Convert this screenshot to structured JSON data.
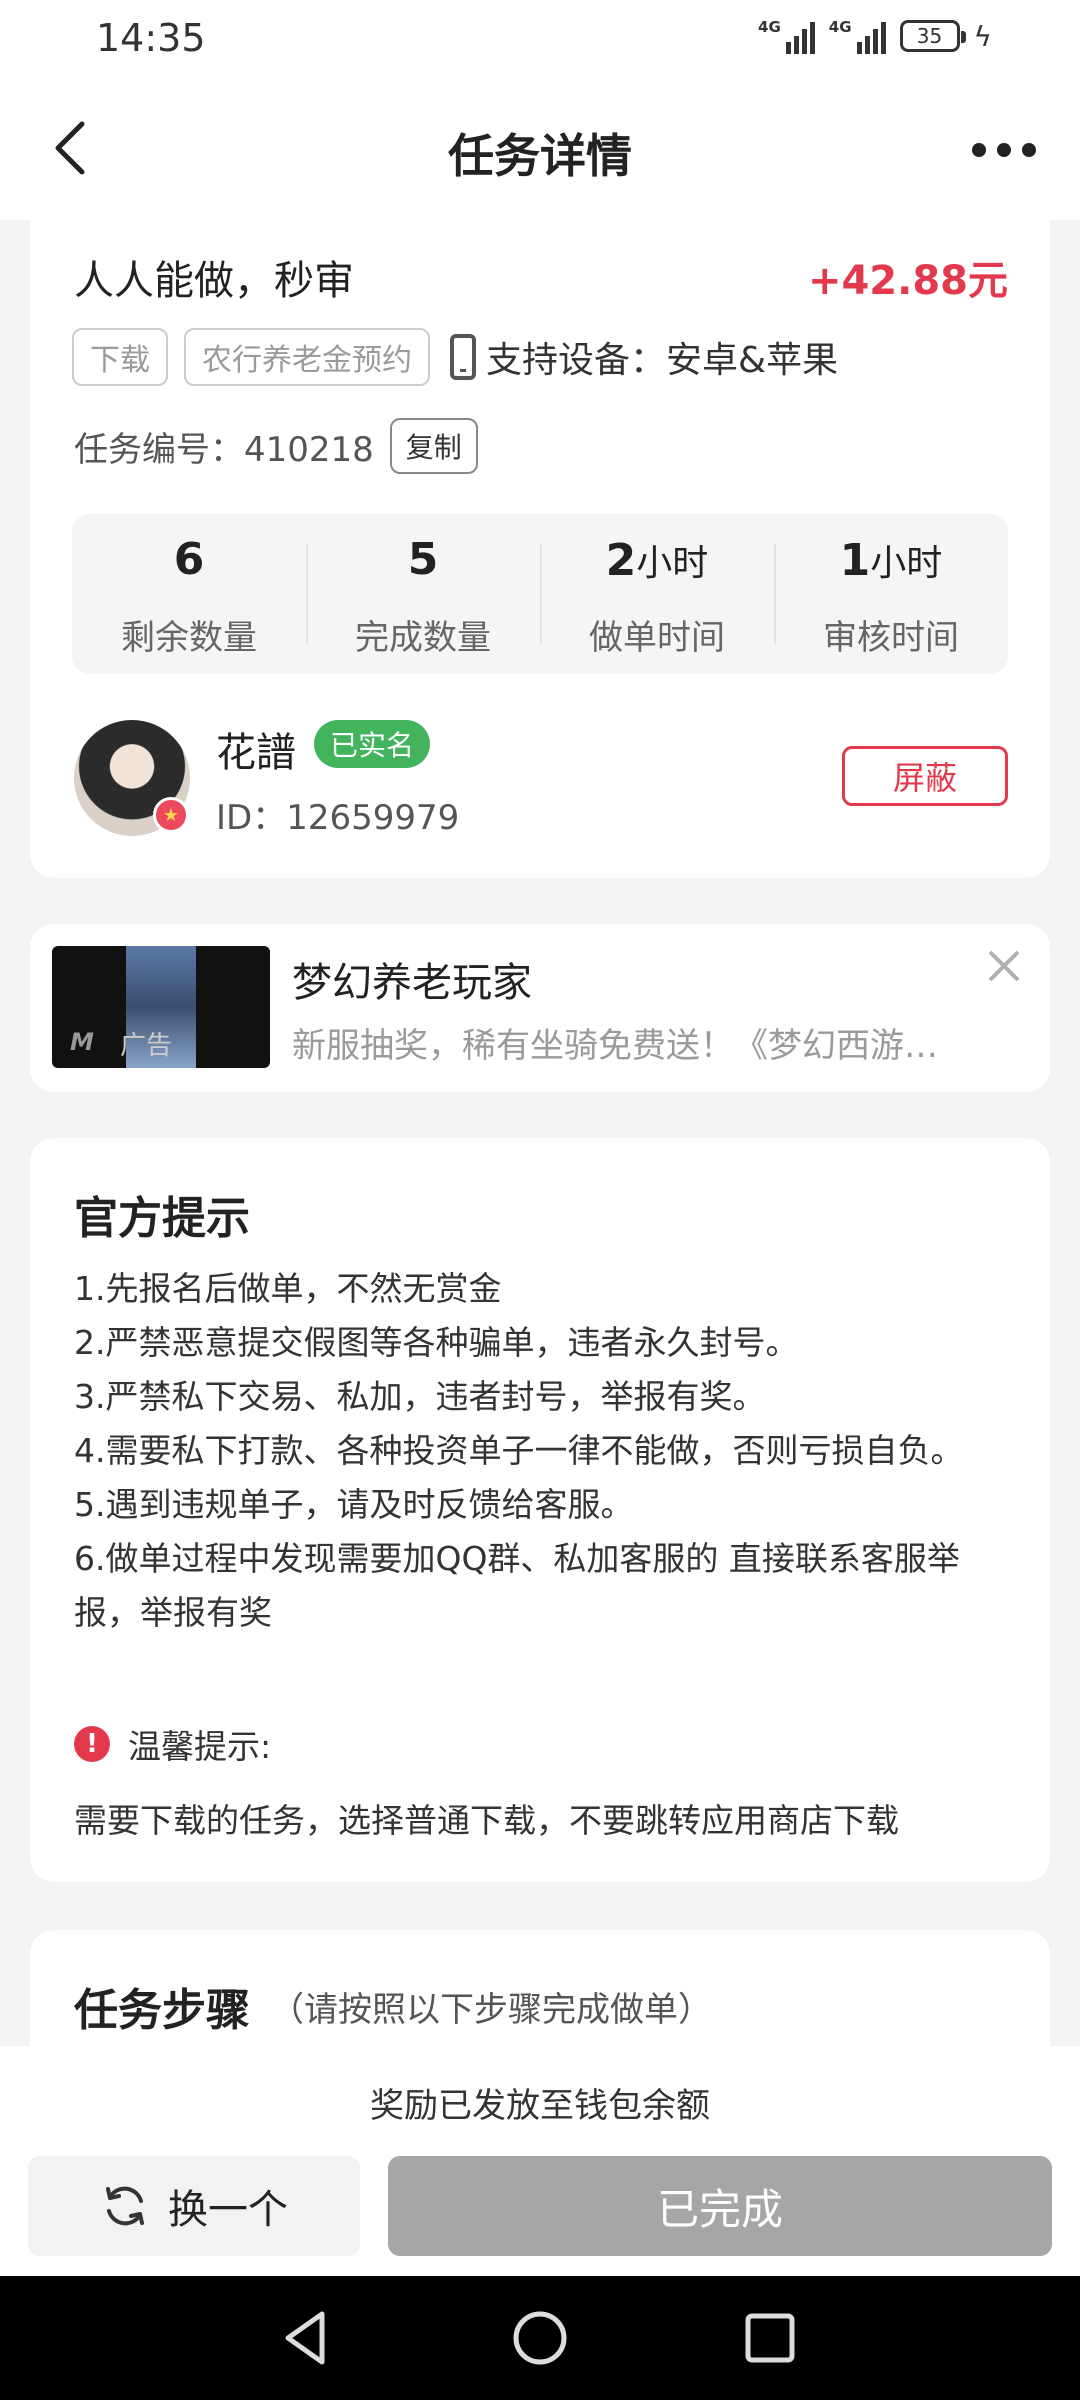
{
  "status_bar": {
    "time": "14:35",
    "signal_1": "4G",
    "signal_2": "4G",
    "battery": "35"
  },
  "header": {
    "title": "任务详情"
  },
  "task": {
    "name": "人人能做，秒审",
    "reward": "+42.88元",
    "tags": [
      "下载",
      "农行养老金预约"
    ],
    "device_label": "支持设备：安卓&苹果",
    "id_label": "任务编号：410218",
    "copy_label": "复制"
  },
  "stats": [
    {
      "value": "6",
      "unit": "",
      "label": "剩余数量"
    },
    {
      "value": "5",
      "unit": "",
      "label": "完成数量"
    },
    {
      "value": "2",
      "unit": "小时",
      "label": "做单时间"
    },
    {
      "value": "1",
      "unit": "小时",
      "label": "审核时间"
    }
  ],
  "publisher": {
    "name": "花譜",
    "verified": "已实名",
    "id_label": "ID：12659979",
    "block_label": "屏蔽"
  },
  "ad": {
    "title": "梦幻养老玩家",
    "description": "新服抽奖，稀有坐骑免费送！《梦幻西游…",
    "label": "广告",
    "logo": "M"
  },
  "tips": {
    "title": "官方提示",
    "items": [
      "1.先报名后做单，不然无赏金",
      "2.严禁恶意提交假图等各种骗单，违者永久封号。",
      "3.严禁私下交易、私加，违者封号，举报有奖。",
      "4.需要私下打款、各种投资单子一律不能做，否则亏损自负。",
      "5.遇到违规单子，请及时反馈给客服。",
      "6.做单过程中发现需要加QQ群、私加客服的 直接联系客服举报，举报有奖"
    ],
    "warm_label": "温馨提示:",
    "warm_text": "需要下载的任务，选择普通下载，不要跳转应用商店下载"
  },
  "steps": {
    "title": "任务步骤",
    "note": "（请按照以下步骤完成做单）"
  },
  "bottom": {
    "notice": "奖励已发放至钱包余额",
    "swap_label": "换一个",
    "done_label": "已完成"
  },
  "colors": {
    "accent": "#e23a4c",
    "verified": "#43b35c",
    "disabled": "#a6a6a6"
  }
}
